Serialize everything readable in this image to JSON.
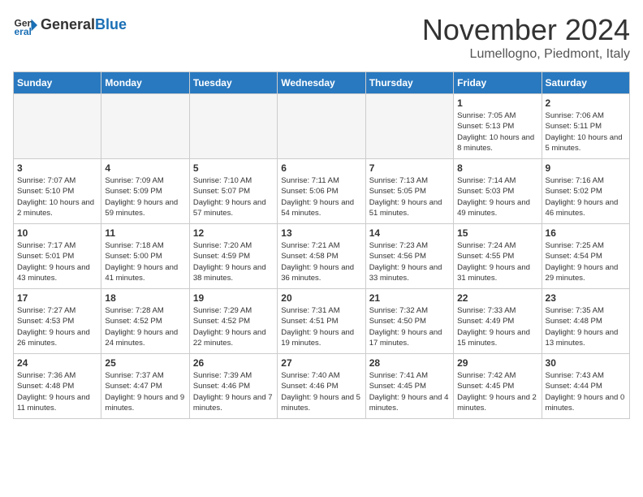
{
  "header": {
    "logo_line1": "General",
    "logo_line2": "Blue",
    "month_title": "November 2024",
    "subtitle": "Lumellogno, Piedmont, Italy"
  },
  "days_of_week": [
    "Sunday",
    "Monday",
    "Tuesday",
    "Wednesday",
    "Thursday",
    "Friday",
    "Saturday"
  ],
  "weeks": [
    [
      {
        "day": "",
        "info": ""
      },
      {
        "day": "",
        "info": ""
      },
      {
        "day": "",
        "info": ""
      },
      {
        "day": "",
        "info": ""
      },
      {
        "day": "",
        "info": ""
      },
      {
        "day": "1",
        "info": "Sunrise: 7:05 AM\nSunset: 5:13 PM\nDaylight: 10 hours\nand 8 minutes."
      },
      {
        "day": "2",
        "info": "Sunrise: 7:06 AM\nSunset: 5:11 PM\nDaylight: 10 hours\nand 5 minutes."
      }
    ],
    [
      {
        "day": "3",
        "info": "Sunrise: 7:07 AM\nSunset: 5:10 PM\nDaylight: 10 hours\nand 2 minutes."
      },
      {
        "day": "4",
        "info": "Sunrise: 7:09 AM\nSunset: 5:09 PM\nDaylight: 9 hours\nand 59 minutes."
      },
      {
        "day": "5",
        "info": "Sunrise: 7:10 AM\nSunset: 5:07 PM\nDaylight: 9 hours\nand 57 minutes."
      },
      {
        "day": "6",
        "info": "Sunrise: 7:11 AM\nSunset: 5:06 PM\nDaylight: 9 hours\nand 54 minutes."
      },
      {
        "day": "7",
        "info": "Sunrise: 7:13 AM\nSunset: 5:05 PM\nDaylight: 9 hours\nand 51 minutes."
      },
      {
        "day": "8",
        "info": "Sunrise: 7:14 AM\nSunset: 5:03 PM\nDaylight: 9 hours\nand 49 minutes."
      },
      {
        "day": "9",
        "info": "Sunrise: 7:16 AM\nSunset: 5:02 PM\nDaylight: 9 hours\nand 46 minutes."
      }
    ],
    [
      {
        "day": "10",
        "info": "Sunrise: 7:17 AM\nSunset: 5:01 PM\nDaylight: 9 hours\nand 43 minutes."
      },
      {
        "day": "11",
        "info": "Sunrise: 7:18 AM\nSunset: 5:00 PM\nDaylight: 9 hours\nand 41 minutes."
      },
      {
        "day": "12",
        "info": "Sunrise: 7:20 AM\nSunset: 4:59 PM\nDaylight: 9 hours\nand 38 minutes."
      },
      {
        "day": "13",
        "info": "Sunrise: 7:21 AM\nSunset: 4:58 PM\nDaylight: 9 hours\nand 36 minutes."
      },
      {
        "day": "14",
        "info": "Sunrise: 7:23 AM\nSunset: 4:56 PM\nDaylight: 9 hours\nand 33 minutes."
      },
      {
        "day": "15",
        "info": "Sunrise: 7:24 AM\nSunset: 4:55 PM\nDaylight: 9 hours\nand 31 minutes."
      },
      {
        "day": "16",
        "info": "Sunrise: 7:25 AM\nSunset: 4:54 PM\nDaylight: 9 hours\nand 29 minutes."
      }
    ],
    [
      {
        "day": "17",
        "info": "Sunrise: 7:27 AM\nSunset: 4:53 PM\nDaylight: 9 hours\nand 26 minutes."
      },
      {
        "day": "18",
        "info": "Sunrise: 7:28 AM\nSunset: 4:52 PM\nDaylight: 9 hours\nand 24 minutes."
      },
      {
        "day": "19",
        "info": "Sunrise: 7:29 AM\nSunset: 4:52 PM\nDaylight: 9 hours\nand 22 minutes."
      },
      {
        "day": "20",
        "info": "Sunrise: 7:31 AM\nSunset: 4:51 PM\nDaylight: 9 hours\nand 19 minutes."
      },
      {
        "day": "21",
        "info": "Sunrise: 7:32 AM\nSunset: 4:50 PM\nDaylight: 9 hours\nand 17 minutes."
      },
      {
        "day": "22",
        "info": "Sunrise: 7:33 AM\nSunset: 4:49 PM\nDaylight: 9 hours\nand 15 minutes."
      },
      {
        "day": "23",
        "info": "Sunrise: 7:35 AM\nSunset: 4:48 PM\nDaylight: 9 hours\nand 13 minutes."
      }
    ],
    [
      {
        "day": "24",
        "info": "Sunrise: 7:36 AM\nSunset: 4:48 PM\nDaylight: 9 hours\nand 11 minutes."
      },
      {
        "day": "25",
        "info": "Sunrise: 7:37 AM\nSunset: 4:47 PM\nDaylight: 9 hours\nand 9 minutes."
      },
      {
        "day": "26",
        "info": "Sunrise: 7:39 AM\nSunset: 4:46 PM\nDaylight: 9 hours\nand 7 minutes."
      },
      {
        "day": "27",
        "info": "Sunrise: 7:40 AM\nSunset: 4:46 PM\nDaylight: 9 hours\nand 5 minutes."
      },
      {
        "day": "28",
        "info": "Sunrise: 7:41 AM\nSunset: 4:45 PM\nDaylight: 9 hours\nand 4 minutes."
      },
      {
        "day": "29",
        "info": "Sunrise: 7:42 AM\nSunset: 4:45 PM\nDaylight: 9 hours\nand 2 minutes."
      },
      {
        "day": "30",
        "info": "Sunrise: 7:43 AM\nSunset: 4:44 PM\nDaylight: 9 hours\nand 0 minutes."
      }
    ]
  ]
}
